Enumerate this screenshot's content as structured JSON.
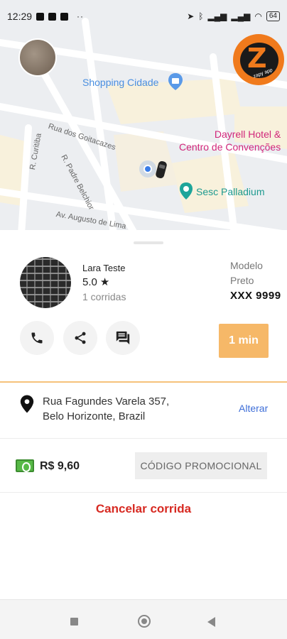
{
  "status_bar": {
    "time": "12:29",
    "battery": "64"
  },
  "map": {
    "poi_shopping": "Shopping Cidade",
    "poi_hotel_line1": "Dayrell Hotel &",
    "poi_hotel_line2": "Centro de Convenções",
    "poi_sesc": "Sesc Palladium",
    "street_goitacazes": "Rua dos Goitacazes",
    "street_curitiba": "R. Curitiba",
    "street_belchior": "R. Padre Belchior",
    "street_augusto": "Av. Augusto de Lima",
    "brand_tag": "zapy app"
  },
  "driver": {
    "name": "Lara Teste",
    "rating": "5.0",
    "rides": "1 corridas"
  },
  "car": {
    "model": "Modelo",
    "color": "Preto",
    "plate": "XXX 9999"
  },
  "eta": "1 min",
  "destination": {
    "address_line1": "Rua Fagundes Varela 357,",
    "address_line2": "Belo Horizonte, Brazil",
    "change_label": "Alterar"
  },
  "payment": {
    "price": "R$ 9,60",
    "promo_label": "CÓDIGO PROMOCIONAL"
  },
  "cancel_label": "Cancelar corrida",
  "colors": {
    "accent": "#f6b868",
    "cancel": "#d72a22",
    "link": "#3e6ed8"
  }
}
